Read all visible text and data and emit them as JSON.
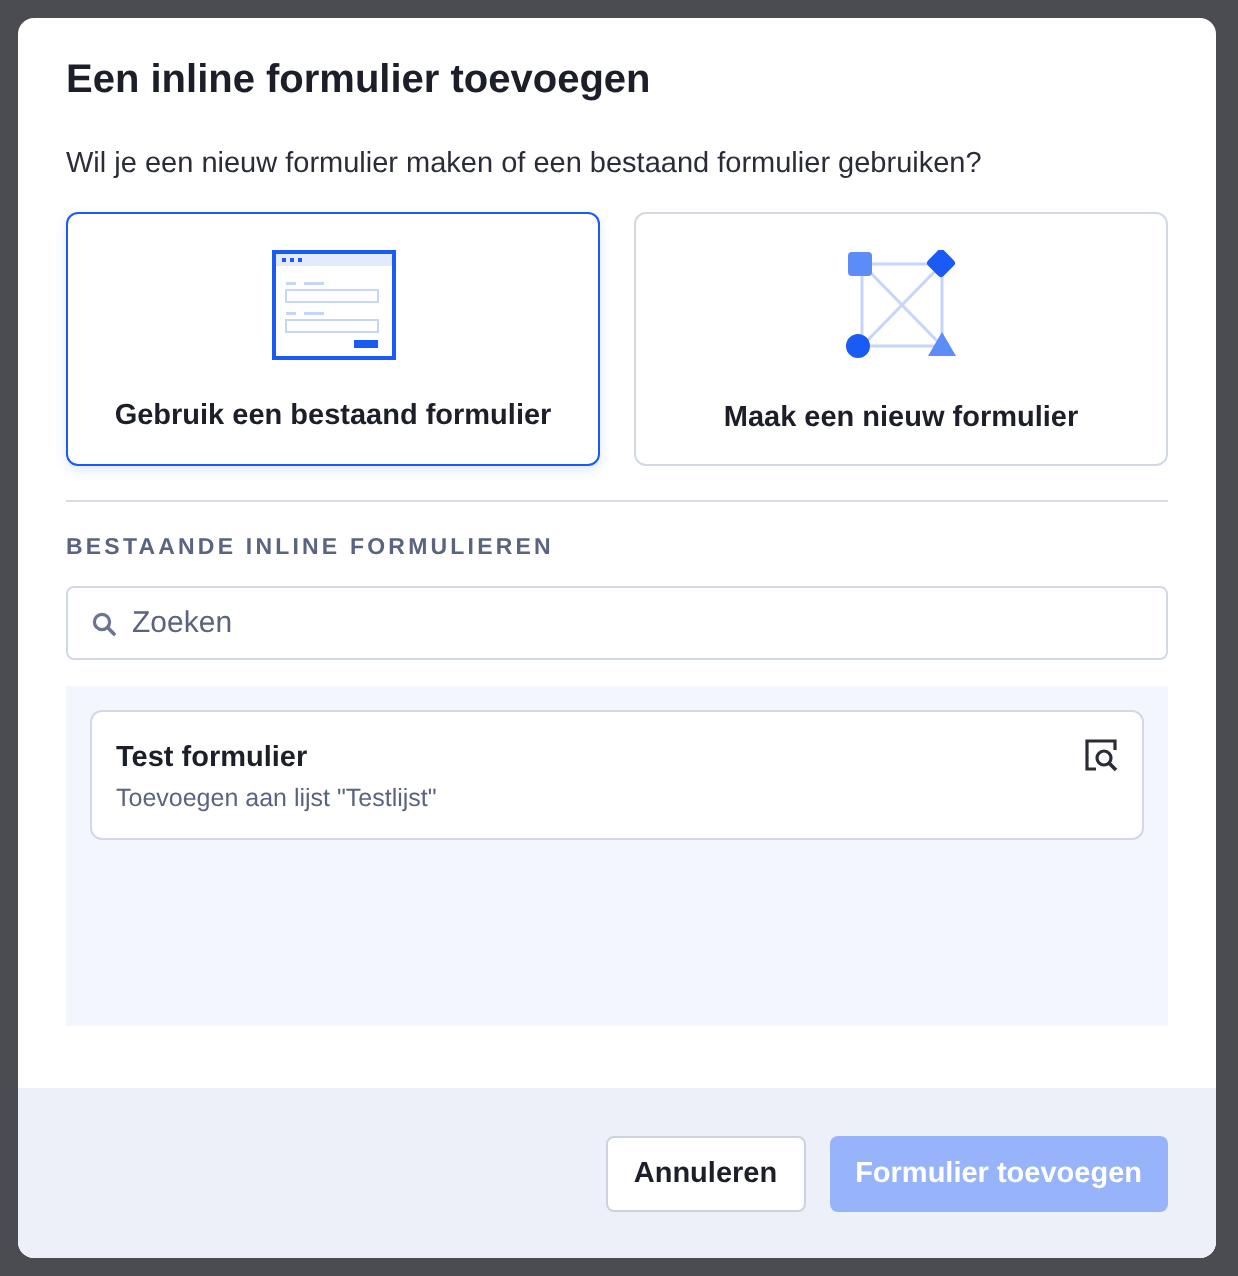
{
  "dialog": {
    "title": "Een inline formulier toevoegen",
    "question": "Wil je een nieuw formulier maken of een bestaand formulier gebruiken?"
  },
  "options": [
    {
      "kind": "existing",
      "label": "Gebruik een bestaand formulier",
      "selected": true
    },
    {
      "kind": "new",
      "label": "Maak een nieuw formulier",
      "selected": false
    }
  ],
  "section_heading": "BESTAANDE INLINE FORMULIEREN",
  "search": {
    "placeholder": "Zoeken"
  },
  "forms": [
    {
      "title": "Test formulier",
      "subtitle": "Toevoegen aan lijst \"Testlijst\""
    }
  ],
  "buttons": [
    {
      "kind": "secondary",
      "label": "Annuleren",
      "disabled": false
    },
    {
      "kind": "primary",
      "label": "Formulier toevoegen",
      "disabled": true
    }
  ]
}
